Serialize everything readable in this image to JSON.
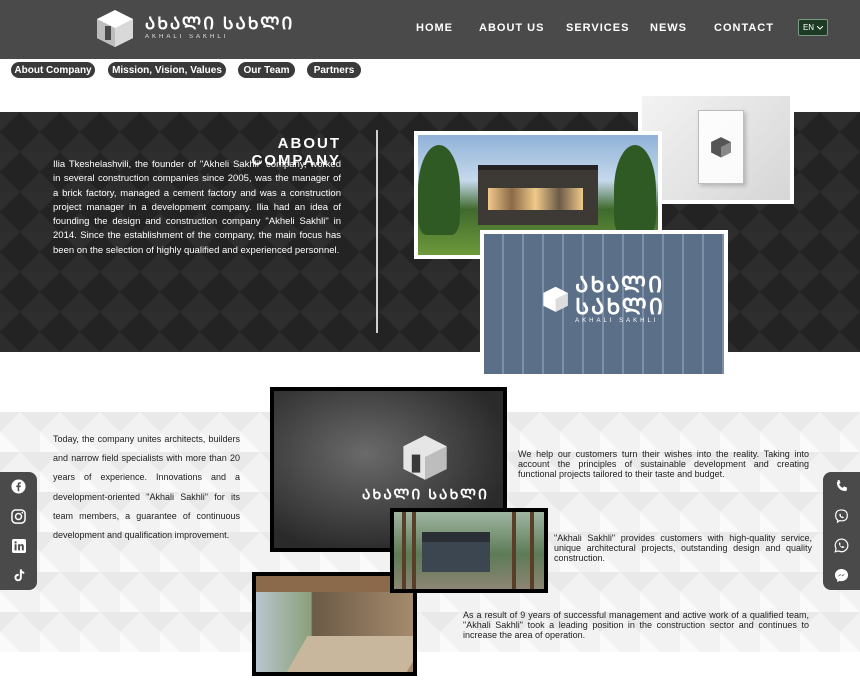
{
  "header": {
    "logo": {
      "word": "ᲐᲮᲐᲚᲘ ᲡᲐᲮᲚᲘ",
      "sub": "AKHALI SAKHLI"
    },
    "nav": [
      {
        "label": "HOME"
      },
      {
        "label": "ABOUT US"
      },
      {
        "label": "SERVICES"
      },
      {
        "label": "NEWS"
      },
      {
        "label": "CONTACT"
      }
    ],
    "language": {
      "selected": "EN"
    }
  },
  "subnav": [
    {
      "label": "About Company"
    },
    {
      "label": "Mission, Vision, Values"
    },
    {
      "label": "Our Team"
    },
    {
      "label": "Partners"
    }
  ],
  "about": {
    "title": "ABOUT COMPANY",
    "text": "Ilia Tkeshelashvili, the founder of \"Akheli Sakhli\" company, worked in several construction companies since 2005, was the manager of a brick factory, managed a cement factory and was a construction project manager in a development company. Ilia had an idea of founding the design and construction company \"Akheli Sakhli\" in 2014. Since the establishment of the company, the main focus has been on the selection of highly qualified and experienced personnel."
  },
  "lower": {
    "left_text": "Today, the company unites architects, builders and narrow field specialists with more than 20 years of experience. Innovations and a development-oriented \"Akhali Sakhli\" for its team members, a guarantee of continuous development and qualification improvement.",
    "right_p1": "We help our customers turn their wishes into the reality. Taking into account the principles of sustainable development and creating functional projects tailored to their taste and budget.",
    "right_p2": "\"Akhali Sakhli\" provides customers with high-quality service, unique architectural projects, outstanding design and quality construction.",
    "right_p3": "As a result of 9 years of successful management and active work of a qualified team, \"Akhali Sakhli\" took a leading position in the construction sector and continues to increase the area of operation."
  },
  "social_left": [
    "facebook-icon",
    "instagram-icon",
    "linkedin-icon",
    "tiktok-icon"
  ],
  "contact_right": [
    "phone-icon",
    "viber-icon",
    "whatsapp-icon",
    "messenger-icon"
  ],
  "colors": {
    "header": "#4a4a4a",
    "band": "#232323",
    "pill": "#3a3a3a",
    "lang_bg": "#1d3b24"
  }
}
